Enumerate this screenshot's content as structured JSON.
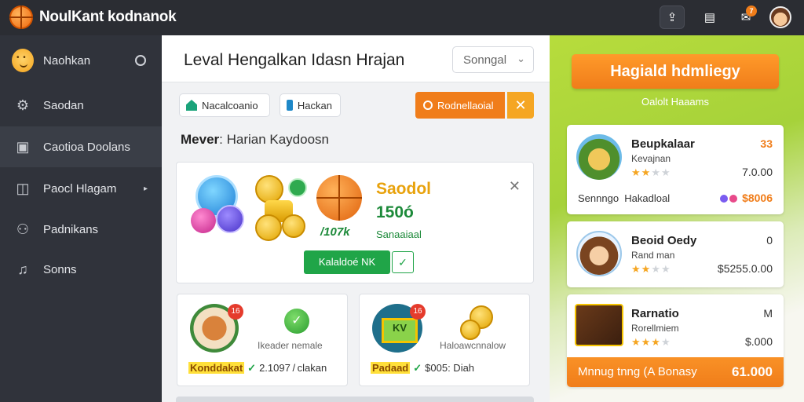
{
  "app": {
    "title": "NoulKant kodnanok"
  },
  "topbar": {
    "notif_count": "7"
  },
  "sidebar": {
    "items": [
      {
        "label": "Naohkan"
      },
      {
        "label": "Saodan"
      },
      {
        "label": "Caotioa Doolans"
      },
      {
        "label": "Paocl Hlagam"
      },
      {
        "label": "Padnikans"
      },
      {
        "label": "Sonns"
      }
    ]
  },
  "main": {
    "title": "Leval Hengalkan Idasn Hrajan",
    "dropdown_value": "Sonngal",
    "chips": [
      "Nacalcoanio",
      "Hackan"
    ],
    "primary_button": "Rodnellaoial",
    "subline_bold": "Mever",
    "subline_rest": ": Harian Kaydoosn",
    "featured": {
      "title": "Saodol",
      "value": "150ó",
      "percent": "/107k",
      "subtitle": "Sanaaiaal",
      "button": "Kalaldoé NK"
    },
    "cards": [
      {
        "caption": "Ikeader nemale",
        "badge": "16",
        "tag": "Konddakat",
        "footer": "2.1097 / clakan"
      },
      {
        "caption": "Haloawcnnalow",
        "badge": "16",
        "tag": "Padaad",
        "footer": "$005: Diah"
      }
    ]
  },
  "right": {
    "banner_button": "Hagiald hdmliegy",
    "banner_sub": "Oalolt Haaams",
    "items": [
      {
        "name": "Beupkalaar",
        "sub": "Kevajnan",
        "tag": "33",
        "price": "7.0.00",
        "stars": 2,
        "extra_left": "Sennngo",
        "extra_mid": "Hakadloal",
        "extra_price": "$8006"
      },
      {
        "name": "Beoid Oedy",
        "sub": "Rand man",
        "tag": "0",
        "price": "$5255.0.00",
        "stars": 2
      },
      {
        "name": "Rarnatio",
        "sub": "Rorellmiem",
        "tag": "M",
        "price": "$.000",
        "stars": 3,
        "bar_text": "Mnnug tnng (A Bonasy",
        "bar_value": "61.000"
      }
    ]
  },
  "colors": {
    "accent_orange": "#f07d1a",
    "accent_green": "#20a548",
    "sidebar_bg": "#30333b",
    "topbar_bg": "#2b2d33"
  }
}
